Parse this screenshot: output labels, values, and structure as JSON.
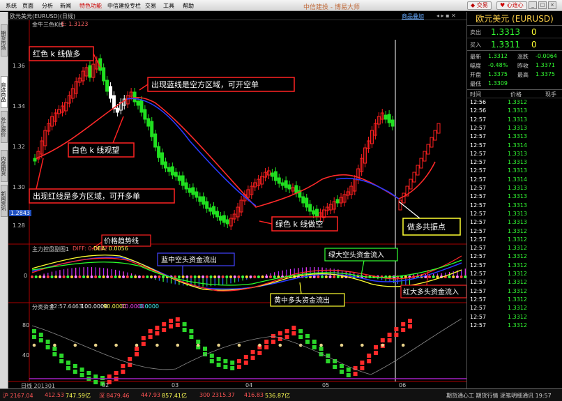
{
  "menu": {
    "items": [
      "系统",
      "页面",
      "分析",
      "新闻",
      "特色功能",
      "中信建投专栏",
      "交易",
      "工具",
      "帮助"
    ],
    "brand": "中信建投 - 博易大师",
    "trade_btn": "交易",
    "help_btn": "心连心"
  },
  "side_tabs": [
    "期货市场",
    "自选商品",
    "外汇报价",
    "内盘期货",
    "新闻资讯"
  ],
  "chart": {
    "title": "欧元美元(EURUSD)(日线)",
    "indicator_main": "金牛三色K线",
    "indicator_main_val": "E: 1.3123",
    "overlay_btn": "商品叠加",
    "price_ticks": [
      "1.36",
      "1.34",
      "1.32",
      "1.30",
      "1.28"
    ],
    "current_price_tag": "1.2843",
    "sub1_title": "主力控盘副图1",
    "sub1_diff": "DIFF: 0.0082",
    "sub1_dea": "DEA: 0.0056",
    "sub1_zero": "0",
    "sub2_title": "分类资金",
    "sub2_vals": [
      "82:57.6463",
      "100.0000",
      "90.0000",
      "10.0000",
      "0.0000"
    ],
    "sub2_ticks": [
      "80",
      "40"
    ],
    "date_start": "日线 201301",
    "months": [
      "02",
      "03",
      "04",
      "05",
      "06"
    ]
  },
  "annotations": {
    "red_k": "红色 k 线做多",
    "blue_line": "出现蓝线是空方区域，可开空单",
    "white_k": "白色 k 线观望",
    "red_line": "出现红线是多方区域，可开多单",
    "green_k": "绿色 k 线做空",
    "resonance": "做多共振点",
    "price_trend": "价格趋势线",
    "blue_mid": "蓝中空头资金流出",
    "green_big": "绿大空头资金流入",
    "yellow_mid": "黄中多头资金流出",
    "red_big": "红大多头资金流入"
  },
  "quote": {
    "name": "欧元美元 (EURUSD)",
    "sell_label": "卖出",
    "sell_price": "1.3313",
    "sell_vol": "0",
    "buy_label": "买入",
    "buy_price": "1.3311",
    "buy_vol": "0",
    "stats": [
      {
        "l": "最新",
        "v": "1.3312",
        "l2": "涨跌",
        "v2": "-0.0064"
      },
      {
        "l": "幅度",
        "v": "-0.48%",
        "l2": "昨收",
        "v2": "1.3371"
      },
      {
        "l": "开盘",
        "v": "1.3375",
        "l2": "最高",
        "v2": "1.3375"
      },
      {
        "l": "最低",
        "v": "1.3309",
        "l2": "",
        "v2": ""
      }
    ],
    "tick_headers": [
      "时间",
      "价格",
      "现手"
    ],
    "ticks": [
      [
        "12:56",
        "1.3312"
      ],
      [
        "12:56",
        "1.3313"
      ],
      [
        "12:57",
        "1.3313"
      ],
      [
        "12:57",
        "1.3313"
      ],
      [
        "12:57",
        "1.3313"
      ],
      [
        "12:57",
        "1.3314"
      ],
      [
        "12:57",
        "1.3313"
      ],
      [
        "12:57",
        "1.3313"
      ],
      [
        "12:57",
        "1.3313"
      ],
      [
        "12:57",
        "1.3314"
      ],
      [
        "12:57",
        "1.3313"
      ],
      [
        "12:57",
        "1.3313"
      ],
      [
        "12:57",
        "1.3313"
      ],
      [
        "12:57",
        "1.3313"
      ],
      [
        "12:57",
        "1.3313"
      ],
      [
        "12:57",
        "1.3312"
      ],
      [
        "12:57",
        "1.3312"
      ],
      [
        "12:57",
        "1.3312"
      ],
      [
        "12:57",
        "1.3312"
      ],
      [
        "12:57",
        "1.3312"
      ],
      [
        "12:57",
        "1.3312"
      ],
      [
        "12:57",
        "1.3312"
      ],
      [
        "12:57",
        "1.3312"
      ],
      [
        "12:57",
        "1.3312"
      ],
      [
        "12:57",
        "1.3312"
      ],
      [
        "12:57",
        "1.3312"
      ],
      [
        "12:57",
        "1.3312"
      ]
    ]
  },
  "bottom": {
    "items": [
      "沪 2167.04",
      "412.53",
      "747.59亿",
      "深 8479.46",
      "447.93",
      "857.41亿",
      "300 2315.37",
      "416.83",
      "536.87亿"
    ],
    "right": "期货通心工  期货行情  逐笔明细通讯  19:57"
  }
}
